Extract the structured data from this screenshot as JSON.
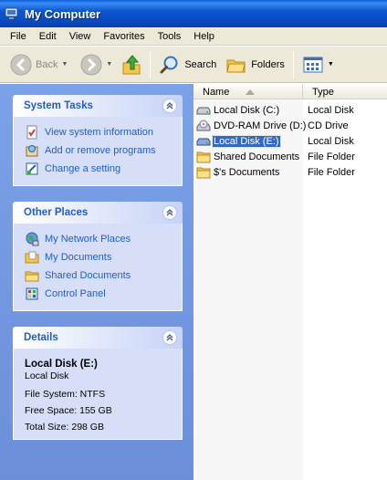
{
  "window": {
    "title": "My Computer"
  },
  "menu": [
    "File",
    "Edit",
    "View",
    "Favorites",
    "Tools",
    "Help"
  ],
  "toolbar": {
    "back_label": "Back",
    "search_label": "Search",
    "folders_label": "Folders"
  },
  "system_tasks": {
    "title": "System Tasks",
    "items": [
      {
        "label": "View system information",
        "icon": "system-info-icon"
      },
      {
        "label": "Add or remove programs",
        "icon": "add-remove-programs-icon"
      },
      {
        "label": "Change a setting",
        "icon": "control-setting-icon"
      }
    ]
  },
  "other_places": {
    "title": "Other Places",
    "items": [
      {
        "label": "My Network Places",
        "icon": "network-places-icon"
      },
      {
        "label": "My Documents",
        "icon": "documents-folder-icon"
      },
      {
        "label": "Shared Documents",
        "icon": "folder-icon"
      },
      {
        "label": "Control Panel",
        "icon": "control-panel-icon"
      }
    ]
  },
  "details": {
    "title": "Details",
    "name": "Local Disk (E:)",
    "kind": "Local Disk",
    "file_system": "File System: NTFS",
    "free_space": "Free Space: 155 GB",
    "total_size": "Total Size: 298 GB"
  },
  "file_list": {
    "columns": {
      "name": "Name",
      "type": "Type"
    },
    "sort_column": "Name",
    "rows": [
      {
        "name": "Local Disk (C:)",
        "type": "Local Disk",
        "icon": "hard-disk-icon",
        "selected": false
      },
      {
        "name": "DVD-RAM Drive (D:)",
        "type": "CD Drive",
        "icon": "dvd-drive-icon",
        "selected": false
      },
      {
        "name": "Local Disk (E:)",
        "type": "Local Disk",
        "icon": "hard-disk-icon",
        "selected": true
      },
      {
        "name": "Shared Documents",
        "type": "File Folder",
        "icon": "folder-icon",
        "selected": false
      },
      {
        "name": "$'s Documents",
        "type": "File Folder",
        "icon": "folder-icon",
        "selected": false
      }
    ]
  },
  "colors": {
    "titlebar": "#0b57d0",
    "taskpane": "#7ba1e8",
    "link": "#215dc6",
    "selection": "#316ac5"
  }
}
